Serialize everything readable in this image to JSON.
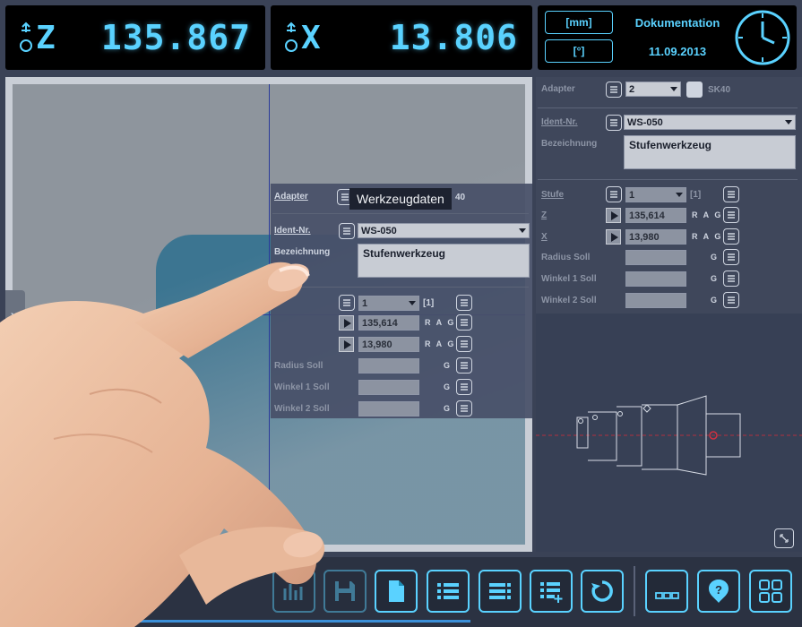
{
  "readouts": {
    "z": {
      "axis": "Z",
      "value": "135.867"
    },
    "x": {
      "axis": "X",
      "value": "13.806"
    }
  },
  "info": {
    "unit_length": "[mm]",
    "unit_angle": "[°]",
    "title": "Dokumentation",
    "date": "11.09.2013"
  },
  "dialog": {
    "adapter_label": "Adapter",
    "adapter_value_partial": "40",
    "tooltip": "Werkzeugdaten",
    "ident_label": "Ident-Nr.",
    "ident_value": "WS-050",
    "bezeichnung_label": "Bezeichnung",
    "bezeichnung_value": "Stufenwerkzeug",
    "stufe_value": "1",
    "stufe_count": "[1]",
    "z_value": "135,614",
    "x_value": "13,980",
    "rag": "R A G",
    "g": "G",
    "radius_label": "Radius Soll",
    "winkel1_label": "Winkel 1 Soll",
    "winkel2_label": "Winkel 2 Soll"
  },
  "right_panel": {
    "adapter_label": "Adapter",
    "adapter_value": "2",
    "adapter_type": "SK40",
    "ident_label": "Ident-Nr.",
    "ident_value": "WS-050",
    "bezeichnung_label": "Bezeichnung",
    "bezeichnung_value": "Stufenwerkzeug",
    "stufe_label": "Stufe",
    "stufe_value": "1",
    "stufe_count": "[1]",
    "z_label": "Z",
    "z_value": "135,614",
    "x_label": "X",
    "x_value": "13,980",
    "rag": "R A G",
    "g": "G",
    "radius_label": "Radius Soll",
    "winkel1_label": "Winkel 1 Soll",
    "winkel2_label": "Winkel 2 Soll"
  },
  "toolbar": {
    "icons": [
      "save-icon",
      "document-icon",
      "list-icon",
      "list-detail-icon",
      "list-add-icon",
      "refresh-icon",
      "ellipsis-icon",
      "help-icon",
      "grid-icon"
    ]
  },
  "colors": {
    "accent": "#5ad2ff",
    "panel": "#3f475b",
    "toolbar": "#2b3242",
    "tool_blue": "#3c7591"
  }
}
